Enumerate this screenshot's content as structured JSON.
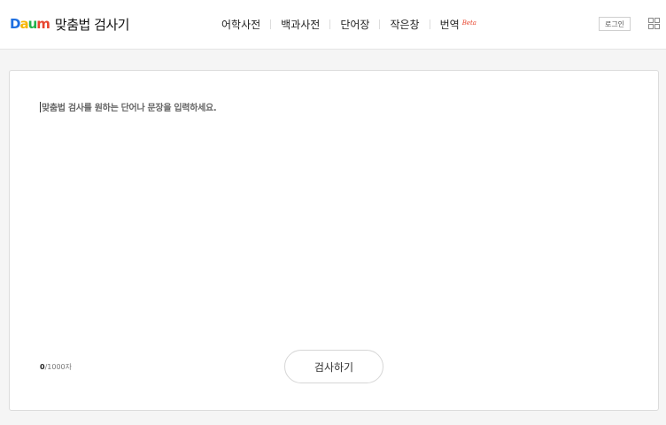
{
  "header": {
    "logo": {
      "letters": [
        {
          "char": "D",
          "color": "#1e6fe0"
        },
        {
          "char": "a",
          "color": "#f7b500"
        },
        {
          "char": "u",
          "color": "#21b14b"
        },
        {
          "char": "m",
          "color": "#e8452e"
        }
      ],
      "title": "맞춤법 검사기"
    },
    "nav": [
      {
        "label": "어학사전"
      },
      {
        "label": "백과사전"
      },
      {
        "label": "단어장"
      },
      {
        "label": "작은창"
      },
      {
        "label": "번역",
        "badge": "Beta"
      }
    ],
    "login_label": "로그인",
    "menu_icon": "grid-icon"
  },
  "editor": {
    "placeholder": "맞춤법 검사를 원하는 단어나 문장을 입력하세요.",
    "count": "0",
    "limit": "/1000자"
  },
  "check_button_label": "검사하기",
  "colors": {
    "background": "#f5f5f5",
    "panel": "#ffffff",
    "border": "#dcdcdc",
    "beta": "#e8452e"
  }
}
